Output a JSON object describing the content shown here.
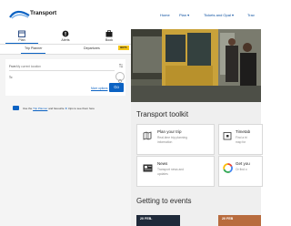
{
  "header": {
    "logo_text": "Transport",
    "nav": [
      "Home",
      "Plan ▾",
      "Tickets and Opal ▾",
      "Trav"
    ]
  },
  "planner": {
    "modes": [
      {
        "label": "Plan",
        "icon": "calendar-icon"
      },
      {
        "label": "Alerts",
        "icon": "alert-icon"
      },
      {
        "label": "Book",
        "icon": "briefcase-icon"
      }
    ],
    "subtabs": [
      "Trip Planner",
      "Departures"
    ],
    "beta_label": "BETA",
    "from_label": "From",
    "from_placeholder": "My current location",
    "to_label": "To",
    "more_options": "More options",
    "go_label": "Go"
  },
  "tip": {
    "prefix": "Use the",
    "link": "Trip Planner",
    "middle": "and favourite",
    "suffix": "trips to see them here"
  },
  "toolkit": {
    "heading": "Transport toolkit",
    "cards": [
      {
        "title": "Plan your trip",
        "desc": [
          "Real-time trip planning",
          "information"
        ],
        "icon": "map-icon"
      },
      {
        "title": "Timetab",
        "desc": [
          "Find a tri",
          "map for"
        ],
        "icon": "calendar-icon"
      },
      {
        "title": "News",
        "desc": [
          "Transport news and",
          "updates"
        ],
        "icon": "newspaper-icon"
      },
      {
        "title": "Get you",
        "desc": [
          "Or find o"
        ],
        "icon": "google-icon"
      }
    ]
  },
  "events": {
    "heading": "Getting to events",
    "items": [
      {
        "label": "20 FEB-"
      },
      {
        "label": "20 FEB"
      }
    ]
  },
  "colors": {
    "accent": "#0b62c3",
    "badge": "#f5c518"
  }
}
